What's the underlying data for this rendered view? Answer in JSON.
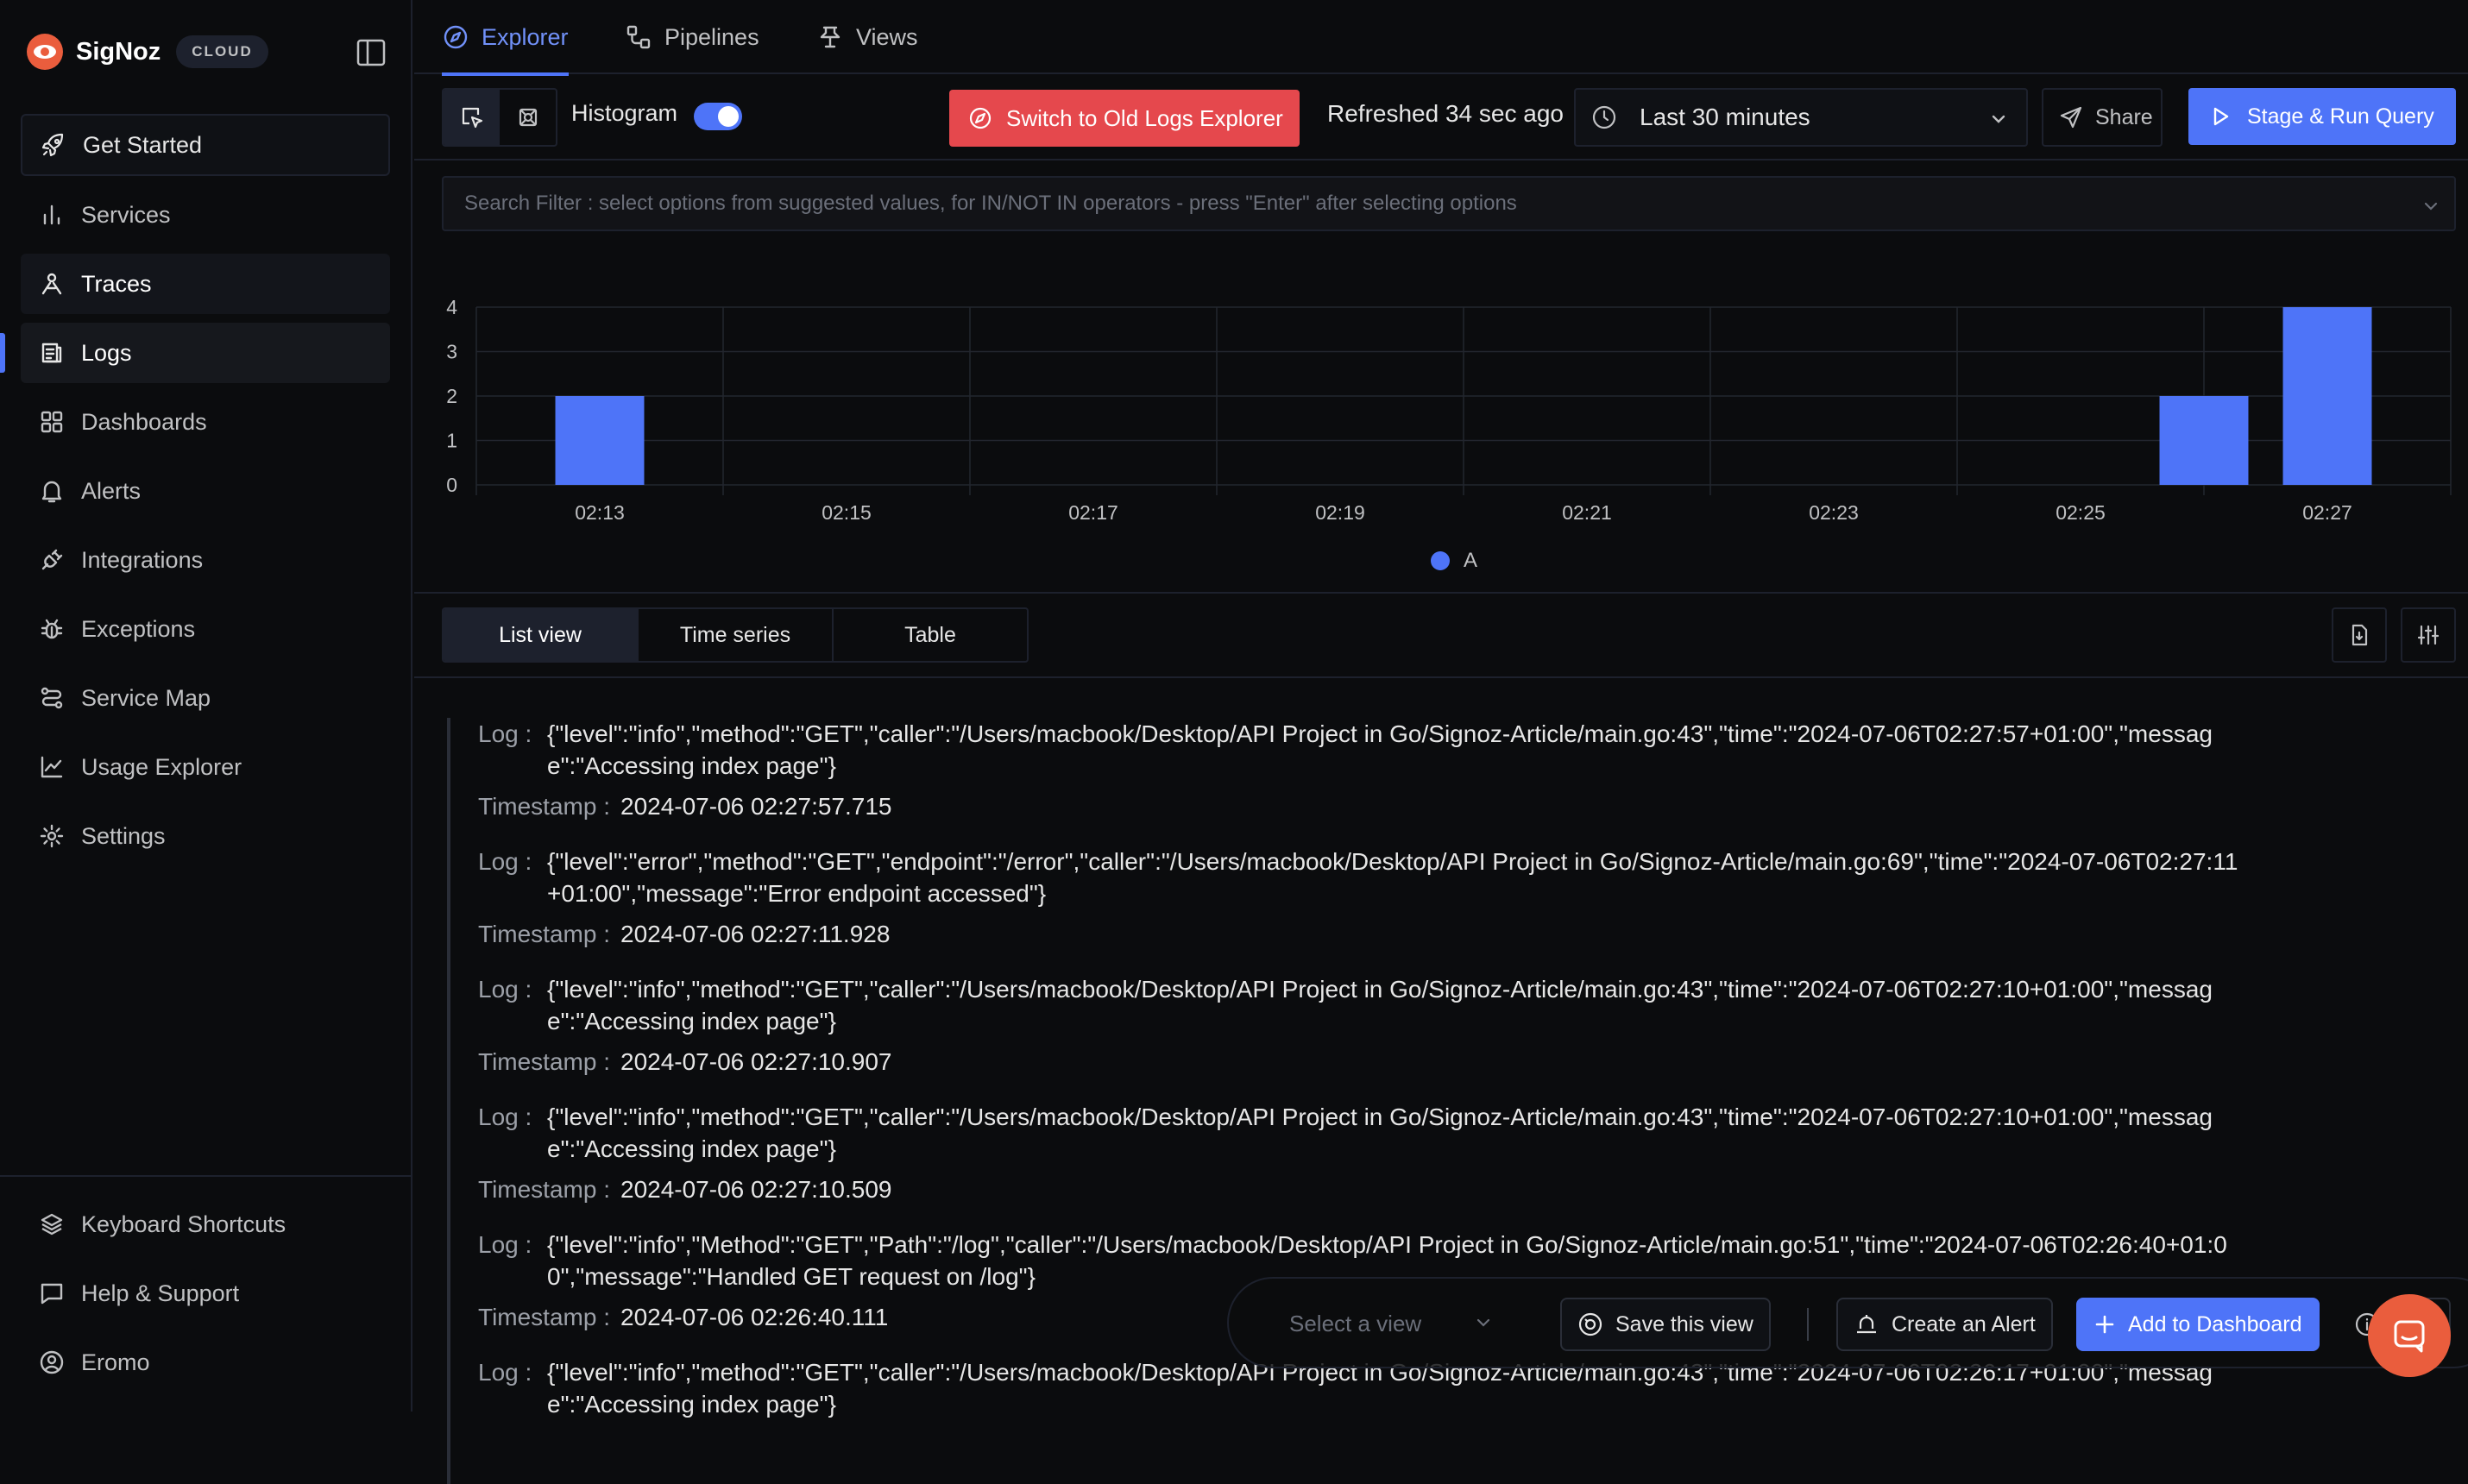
{
  "brand": {
    "name": "SigNoz",
    "badge": "CLOUD"
  },
  "sidebar": {
    "items": [
      {
        "label": "Get Started",
        "icon": "rocket-icon"
      },
      {
        "label": "Services",
        "icon": "bar-chart-icon"
      },
      {
        "label": "Traces",
        "icon": "traces-icon"
      },
      {
        "label": "Logs",
        "icon": "logs-icon"
      },
      {
        "label": "Dashboards",
        "icon": "grid-icon"
      },
      {
        "label": "Alerts",
        "icon": "bell-icon"
      },
      {
        "label": "Integrations",
        "icon": "plug-icon"
      },
      {
        "label": "Exceptions",
        "icon": "bug-icon"
      },
      {
        "label": "Service Map",
        "icon": "route-icon"
      },
      {
        "label": "Usage Explorer",
        "icon": "line-chart-icon"
      },
      {
        "label": "Settings",
        "icon": "gear-icon"
      }
    ],
    "footer": [
      {
        "label": "Keyboard Shortcuts",
        "icon": "layers-icon"
      },
      {
        "label": "Help & Support",
        "icon": "message-icon"
      },
      {
        "label": "Eromo",
        "icon": "user-circle-icon"
      }
    ]
  },
  "topnav": {
    "tabs": [
      "Explorer",
      "Pipelines",
      "Views"
    ]
  },
  "toolbar": {
    "histogram_label": "Histogram",
    "histogram_on": true,
    "old_explorer_label": "Switch to Old Logs Explorer",
    "refreshed": "Refreshed 34 sec ago",
    "time_range": "Last 30 minutes",
    "share_label": "Share",
    "run_label": "Stage & Run Query"
  },
  "search": {
    "placeholder": "Search Filter : select options from suggested values, for IN/NOT IN operators - press \"Enter\" after selecting options"
  },
  "chart_data": {
    "type": "bar",
    "x": [
      "02:13",
      "02:15",
      "02:17",
      "02:19",
      "02:21",
      "02:23",
      "02:25",
      "02:27"
    ],
    "series": [
      {
        "name": "A",
        "points": [
          {
            "t": "02:13",
            "value": 2
          },
          {
            "t": "02:26",
            "value": 2
          },
          {
            "t": "02:27",
            "value": 4
          }
        ]
      }
    ],
    "yticks": [
      0,
      1,
      2,
      3,
      4
    ],
    "ylim": [
      0,
      4
    ],
    "grid": true,
    "legend": "bottom-center",
    "bar_color": "#4e74f8"
  },
  "views": {
    "tabs": [
      "List view",
      "Time series",
      "Table"
    ]
  },
  "logs": {
    "log_key": "Log :",
    "timestamp_key": "Timestamp :",
    "items": [
      {
        "body": "{\"level\":\"info\",\"method\":\"GET\",\"caller\":\"/Users/macbook/Desktop/API Project in Go/Signoz-Article/main.go:43\",\"time\":\"2024-07-06T02:27:57+01:00\",\"message\":\"Accessing index page\"}",
        "timestamp": "2024-07-06 02:27:57.715"
      },
      {
        "body": "{\"level\":\"error\",\"method\":\"GET\",\"endpoint\":\"/error\",\"caller\":\"/Users/macbook/Desktop/API Project in Go/Signoz-Article/main.go:69\",\"time\":\"2024-07-06T02:27:11+01:00\",\"message\":\"Error endpoint accessed\"}",
        "timestamp": "2024-07-06 02:27:11.928"
      },
      {
        "body": "{\"level\":\"info\",\"method\":\"GET\",\"caller\":\"/Users/macbook/Desktop/API Project in Go/Signoz-Article/main.go:43\",\"time\":\"2024-07-06T02:27:10+01:00\",\"message\":\"Accessing index page\"}",
        "timestamp": "2024-07-06 02:27:10.907"
      },
      {
        "body": "{\"level\":\"info\",\"method\":\"GET\",\"caller\":\"/Users/macbook/Desktop/API Project in Go/Signoz-Article/main.go:43\",\"time\":\"2024-07-06T02:27:10+01:00\",\"message\":\"Accessing index page\"}",
        "timestamp": "2024-07-06 02:27:10.509"
      },
      {
        "body": "{\"level\":\"info\",\"Method\":\"GET\",\"Path\":\"/log\",\"caller\":\"/Users/macbook/Desktop/API Project in Go/Signoz-Article/main.go:51\",\"time\":\"2024-07-06T02:26:40+01:00\",\"message\":\"Handled GET request on /log\"}",
        "timestamp": "2024-07-06 02:26:40.111"
      },
      {
        "body": "{\"level\":\"info\",\"method\":\"GET\",\"caller\":\"/Users/macbook/Desktop/API Project in Go/Signoz-Article/main.go:43\",\"time\":\"2024-07-06T02:26:17+01:00\",\"message\":\"Accessing index page\"}",
        "timestamp": ""
      }
    ]
  },
  "floatbar": {
    "select_placeholder": "Select a view",
    "save_label": "Save this view",
    "alert_label": "Create an Alert",
    "dashboard_label": "Add to Dashboard"
  }
}
